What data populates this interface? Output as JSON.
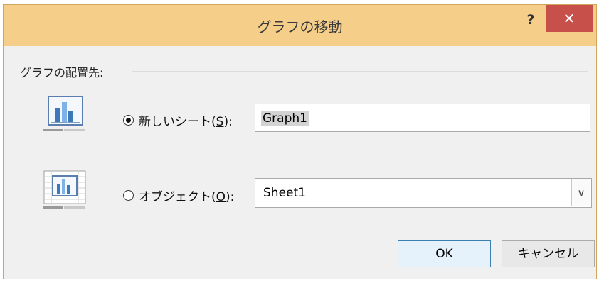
{
  "dialog": {
    "title": "グラフの移動",
    "help_label": "?",
    "close_label": "✕"
  },
  "group": {
    "label": "グラフの配置先:"
  },
  "options": {
    "new_sheet": {
      "label": "新しいシート(",
      "accel": "S",
      "suffix": "):",
      "selected": true,
      "value": "Graph1",
      "icon": "new-sheet-chart-icon"
    },
    "object": {
      "label": "オブジェクト(",
      "accel": "O",
      "suffix": "):",
      "selected": false,
      "value": "Sheet1",
      "icon": "embedded-chart-icon"
    }
  },
  "buttons": {
    "ok": "OK",
    "cancel": "キャンセル"
  },
  "colors": {
    "titlebar": "#f5cf89",
    "close": "#c7504b"
  }
}
